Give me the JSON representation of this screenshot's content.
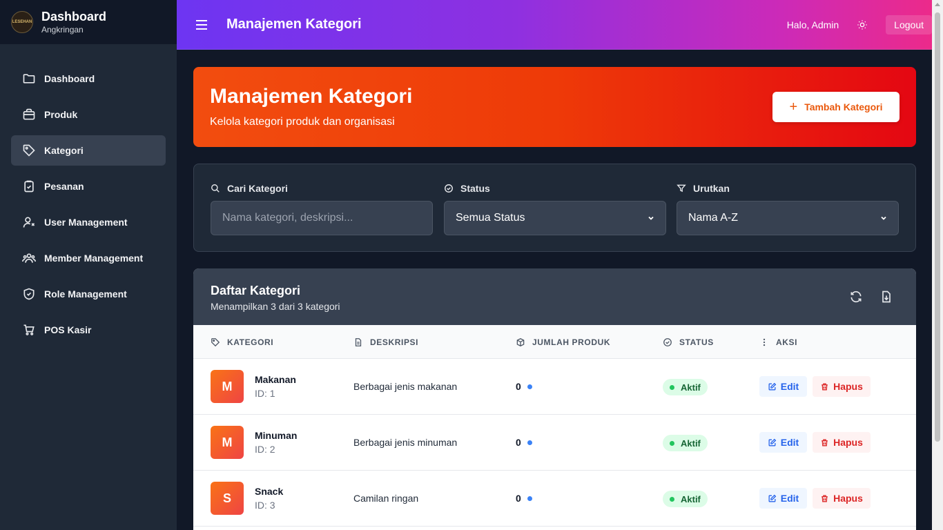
{
  "brand": {
    "title": "Dashboard",
    "subtitle": "Angkringan",
    "logo_text": "LESEHAN"
  },
  "sidebar": {
    "items": [
      {
        "label": "Dashboard",
        "icon": "folder-icon"
      },
      {
        "label": "Produk",
        "icon": "box-icon"
      },
      {
        "label": "Kategori",
        "icon": "tag-icon",
        "active": true
      },
      {
        "label": "Pesanan",
        "icon": "clipboard-icon"
      },
      {
        "label": "User Management",
        "icon": "user-gear-icon"
      },
      {
        "label": "Member Management",
        "icon": "users-icon"
      },
      {
        "label": "Role Management",
        "icon": "shield-icon"
      },
      {
        "label": "POS Kasir",
        "icon": "cart-icon"
      }
    ]
  },
  "topbar": {
    "title": "Manajemen Kategori",
    "greeting": "Halo, Admin",
    "logout_label": "Logout"
  },
  "hero": {
    "title": "Manajemen Kategori",
    "subtitle": "Kelola kategori produk dan organisasi",
    "add_label": "Tambah Kategori"
  },
  "filters": {
    "search": {
      "label": "Cari Kategori",
      "placeholder": "Nama kategori, deskripsi..."
    },
    "status": {
      "label": "Status",
      "value": "Semua Status"
    },
    "sort": {
      "label": "Urutkan",
      "value": "Nama A-Z"
    }
  },
  "table": {
    "title": "Daftar Kategori",
    "subtitle": "Menampilkan 3 dari 3 kategori",
    "columns": [
      "KATEGORI",
      "DESKRIPSI",
      "JUMLAH PRODUK",
      "STATUS",
      "AKSI"
    ],
    "edit_label": "Edit",
    "delete_label": "Hapus",
    "rows": [
      {
        "initial": "M",
        "name": "Makanan",
        "id": "ID: 1",
        "description": "Berbagai jenis makanan",
        "count": "0",
        "status": "Aktif"
      },
      {
        "initial": "M",
        "name": "Minuman",
        "id": "ID: 2",
        "description": "Berbagai jenis minuman",
        "count": "0",
        "status": "Aktif"
      },
      {
        "initial": "S",
        "name": "Snack",
        "id": "ID: 3",
        "description": "Camilan ringan",
        "count": "0",
        "status": "Aktif"
      }
    ]
  },
  "colors": {
    "accent": "#ea580c",
    "sidebar_bg": "#1f2937",
    "active_item": "#374151"
  }
}
